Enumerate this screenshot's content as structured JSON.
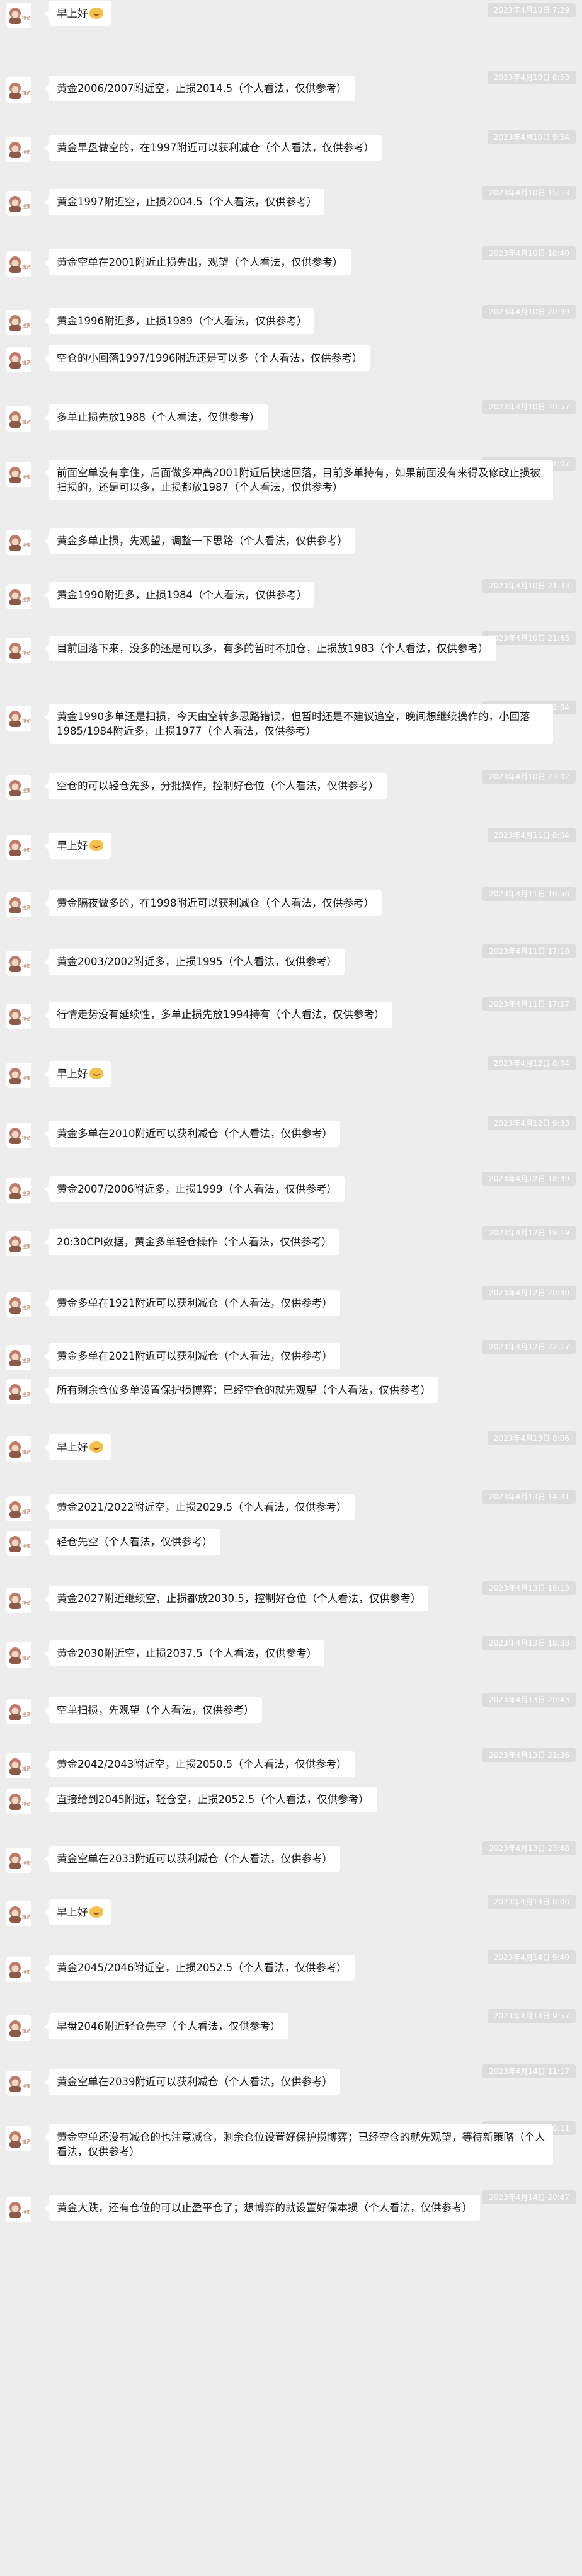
{
  "chat": {
    "sender_avatar_caption": "投资",
    "messages": [
      {
        "time": "2023年4月10日 7:29",
        "text": "早上好",
        "emoji": "smiling-face-icon"
      },
      {
        "time": "2023年4月10日 8:53",
        "text": "黄金2006/2007附近空，止损2014.5（个人看法，仅供参考）"
      },
      {
        "time": "2023年4月10日 9:54",
        "text": "黄金早盘做空的，在1997附近可以获利减仓（个人看法，仅供参考）"
      },
      {
        "time": "2023年4月10日 15:13",
        "text": "黄金1997附近空，止损2004.5（个人看法，仅供参考）"
      },
      {
        "time": "2023年4月10日 18:40",
        "text": "黄金空单在2001附近止损先出，观望（个人看法，仅供参考）"
      },
      {
        "time": "2023年4月10日 20:39",
        "text": "黄金1996附近多，止损1989（个人看法，仅供参考）"
      },
      {
        "time": "",
        "text": "空仓的小回落1997/1996附近还是可以多（个人看法，仅供参考）"
      },
      {
        "time": "2023年4月10日 20:57",
        "text": "多单止损先放1988（个人看法，仅供参考）"
      },
      {
        "time": "2023年4月10日 21:07",
        "text": "前面空单没有拿住，后面做多冲高2001附近后快速回落，目前多单持有，如果前面没有来得及修改止损被扫损的，还是可以多，止损都放1987（个人看法，仅供参考）"
      },
      {
        "time": "",
        "text": "黄金多单止损，先观望，调整一下思路（个人看法，仅供参考）"
      },
      {
        "time": "2023年4月10日 21:33",
        "text": "黄金1990附近多，止损1984（个人看法，仅供参考）"
      },
      {
        "time": "2023年4月10日 21:45",
        "text": "目前回落下来，没多的还是可以多，有多的暂时不加仓，止损放1983（个人看法，仅供参考）"
      },
      {
        "time": "2023年4月10日 22:04",
        "text": "黄金1990多单还是扫损，今天由空转多思路错误，但暂时还是不建议追空，晚间想继续操作的，小回落1985/1984附近多，止损1977（个人看法，仅供参考）"
      },
      {
        "time": "2023年4月10日 23:02",
        "text": "空仓的可以轻仓先多，分批操作，控制好仓位（个人看法，仅供参考）"
      },
      {
        "time": "2023年4月11日 8:04",
        "text": "早上好",
        "emoji": "smiling-face-icon"
      },
      {
        "time": "2023年4月11日 10:56",
        "text": "黄金隔夜做多的，在1998附近可以获利减仓（个人看法，仅供参考）"
      },
      {
        "time": "2023年4月11日 17:18",
        "text": "黄金2003/2002附近多，止损1995（个人看法，仅供参考）"
      },
      {
        "time": "2023年4月11日 17:57",
        "text": "行情走势没有延续性，多单止损先放1994持有（个人看法，仅供参考）"
      },
      {
        "time": "2023年4月12日 8:04",
        "text": "早上好",
        "emoji": "smiling-face-icon"
      },
      {
        "time": "2023年4月12日 9:33",
        "text": "黄金多单在2010附近可以获利减仓（个人看法，仅供参考）"
      },
      {
        "time": "2023年4月12日 18:39",
        "text": "黄金2007/2006附近多，止损1999（个人看法，仅供参考）"
      },
      {
        "time": "2023年4月12日 19:19",
        "text": "20:30CPI数据，黄金多单轻仓操作（个人看法，仅供参考）"
      },
      {
        "time": "2023年4月12日 20:30",
        "text": "黄金多单在1921附近可以获利减仓（个人看法，仅供参考）"
      },
      {
        "time": "2023年4月12日 22:17",
        "text": "黄金多单在2021附近可以获利减仓（个人看法，仅供参考）"
      },
      {
        "time": "",
        "text": "所有剩余仓位多单设置保护损博弈；已经空仓的就先观望（个人看法，仅供参考）"
      },
      {
        "time": "2023年4月13日 8:06",
        "text": "早上好",
        "emoji": "smiling-face-icon"
      },
      {
        "time": "2023年4月13日 14:31",
        "text": "黄金2021/2022附近空，止损2029.5（个人看法，仅供参考）"
      },
      {
        "time": "",
        "text": "轻仓先空（个人看法，仅供参考）"
      },
      {
        "time": "2023年4月13日 16:13",
        "text": "黄金2027附近继续空，止损都放2030.5，控制好仓位（个人看法，仅供参考）"
      },
      {
        "time": "2023年4月13日 18:38",
        "text": "黄金2030附近空，止损2037.5（个人看法，仅供参考）"
      },
      {
        "time": "2023年4月13日 20:43",
        "text": "空单扫损，先观望（个人看法，仅供参考）"
      },
      {
        "time": "2023年4月13日 21:36",
        "text": "黄金2042/2043附近空，止损2050.5（个人看法，仅供参考）"
      },
      {
        "time": "",
        "text": "直接给到2045附近，轻仓空，止损2052.5（个人看法，仅供参考）"
      },
      {
        "time": "2023年4月13日 23:48",
        "text": "黄金空单在2033附近可以获利减仓（个人看法，仅供参考）"
      },
      {
        "time": "2023年4月14日 8:06",
        "text": "早上好",
        "emoji": "smiling-face-icon"
      },
      {
        "time": "2023年4月14日 9:40",
        "text": "黄金2045/2046附近空，止损2052.5（个人看法，仅供参考）"
      },
      {
        "time": "2023年4月14日 9:57",
        "text": "早盘2046附近轻仓先空（个人看法，仅供参考）"
      },
      {
        "time": "2023年4月14日 11:17",
        "text": "黄金空单在2039附近可以获利减仓（个人看法，仅供参考）"
      },
      {
        "time": "2023年4月14日 16:11",
        "text": "黄金空单还没有减仓的也注意减仓，剩余仓位设置好保护损博弈；已经空仓的就先观望，等待新策略（个人看法，仅供参考）"
      },
      {
        "time": "2023年4月14日 20:47",
        "text": "黄金大跌，还有仓位的可以止盈平仓了；想博弈的就设置好保本损（个人看法，仅供参考）"
      }
    ]
  }
}
